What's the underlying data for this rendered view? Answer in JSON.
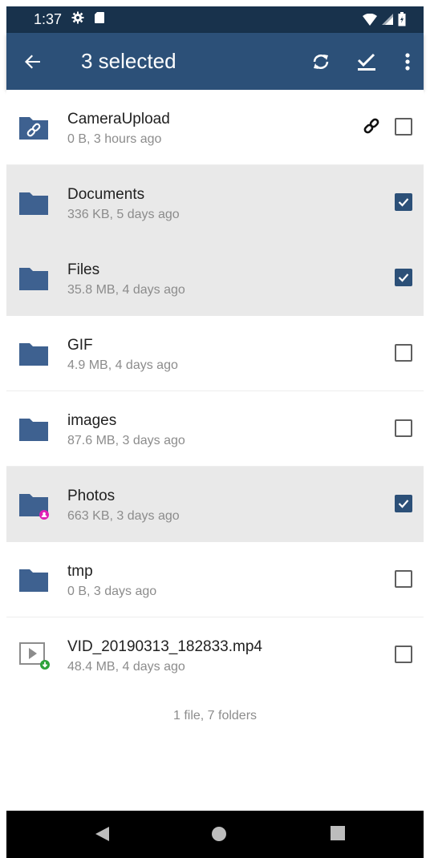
{
  "status_bar": {
    "time": "1:37",
    "icons": [
      "gear-icon",
      "sd-card-icon",
      "wifi-icon",
      "signal-icon",
      "battery-icon"
    ]
  },
  "app_bar": {
    "title": "3 selected",
    "actions": [
      "back-arrow-icon",
      "sync-icon",
      "select-all-icon",
      "more-vert-icon"
    ]
  },
  "items": [
    {
      "name": "CameraUpload",
      "meta": "0 B, 3 hours ago",
      "selected": false,
      "icon": "shared-link-folder-icon",
      "has_link": true
    },
    {
      "name": "Documents",
      "meta": "336 KB, 5 days ago",
      "selected": true,
      "icon": "folder-icon"
    },
    {
      "name": "Files",
      "meta": "35.8 MB, 4 days ago",
      "selected": true,
      "icon": "folder-icon"
    },
    {
      "name": "GIF",
      "meta": "4.9 MB, 4 days ago",
      "selected": false,
      "icon": "folder-icon"
    },
    {
      "name": "images",
      "meta": "87.6 MB, 3 days ago",
      "selected": false,
      "icon": "folder-icon"
    },
    {
      "name": "Photos",
      "meta": "663 KB, 3 days ago",
      "selected": true,
      "icon": "shared-folder-icon"
    },
    {
      "name": "tmp",
      "meta": "0 B, 3 days ago",
      "selected": false,
      "icon": "folder-icon"
    },
    {
      "name": "VID_20190313_182833.mp4",
      "meta": "48.4 MB, 4 days ago",
      "selected": false,
      "icon": "video-file-icon"
    }
  ],
  "footer_text": "1 file, 7 folders",
  "colors": {
    "status_bar": "#18324c",
    "app_bar": "#2c5078",
    "folder": "#3e6190",
    "selected_row": "#e9e9e9",
    "shared_badge": "#e01fb5",
    "offline_badge": "#2ea33a"
  }
}
